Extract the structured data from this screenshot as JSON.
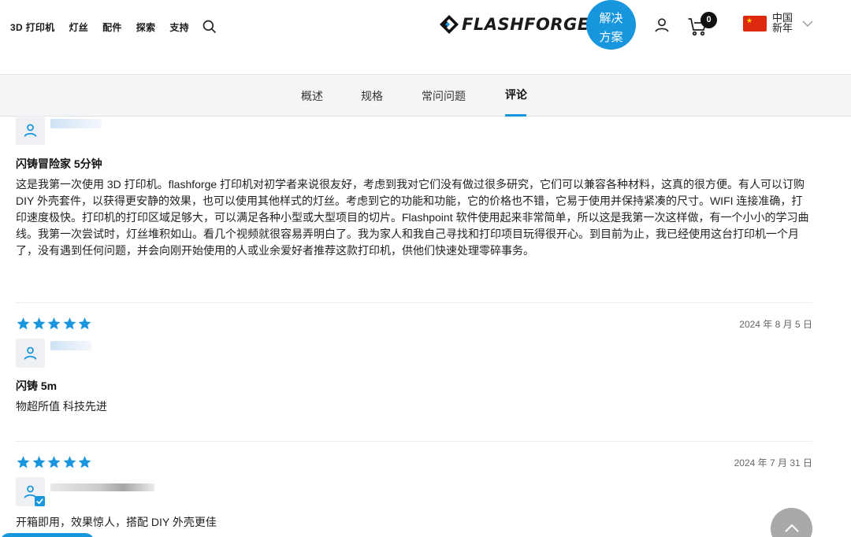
{
  "header": {
    "nav": [
      "3D 打印机",
      "灯丝",
      "配件",
      "探索",
      "支持"
    ],
    "logo_text": "FLASHFORGE",
    "solution_button": [
      "解决",
      "方案"
    ],
    "cart_count": "0",
    "region": [
      "中国",
      "新年"
    ]
  },
  "tabs": [
    {
      "label": "概述",
      "active": false
    },
    {
      "label": "规格",
      "active": false
    },
    {
      "label": "常问问题",
      "active": false
    },
    {
      "label": "评论",
      "active": true
    }
  ],
  "reviews": [
    {
      "title": "闪铸冒险家 5分钟",
      "body": "这是我第一次使用 3D 打印机。flashforge 打印机对初学者来说很友好，考虑到我对它们没有做过很多研究，它们可以兼容各种材料，这真的很方便。有人可以订购 DIY 外壳套件，以获得更安静的效果，也可以使用其他样式的灯丝。考虑到它的功能和功能，它的价格也不错，它易于使用并保持紧凑的尺寸。WIFI 连接准确，打印速度极快。打印机的打印区域足够大，可以满足各种小型或大型项目的切片。Flashpoint 软件使用起来非常简单，所以这是我第一次这样做，有一个小小的学习曲线。我第一次尝试时，灯丝堆积如山。看几个视频就很容易弄明白了。我为家人和我自己寻找和打印项目玩得很开心。到目前为止，我已经使用这台打印机一个月了，没有遇到任何问题，并会向刚开始使用的人或业余爱好者推荐这款打印机，供他们快速处理零碎事务。"
    },
    {
      "rating": 5,
      "date": "2024 年 8 月 5 日",
      "title": "闪铸 5m",
      "body": "物超所值 科技先进"
    },
    {
      "rating": 5,
      "date": "2024 年 7 月 31 日",
      "verified": true,
      "body": "开箱即用，效果惊人，搭配 DIY 外壳更佳"
    }
  ],
  "colors": {
    "accent": "#1796de",
    "subnav_bg": "#f4f5f7",
    "star": "#1796de"
  },
  "icons": [
    "search-icon",
    "logo-diamond-icon",
    "user-icon",
    "cart-icon",
    "china-flag-icon",
    "chevron-down-icon",
    "star-icon",
    "avatar-user-icon",
    "verified-check-icon",
    "chevron-up-icon"
  ]
}
